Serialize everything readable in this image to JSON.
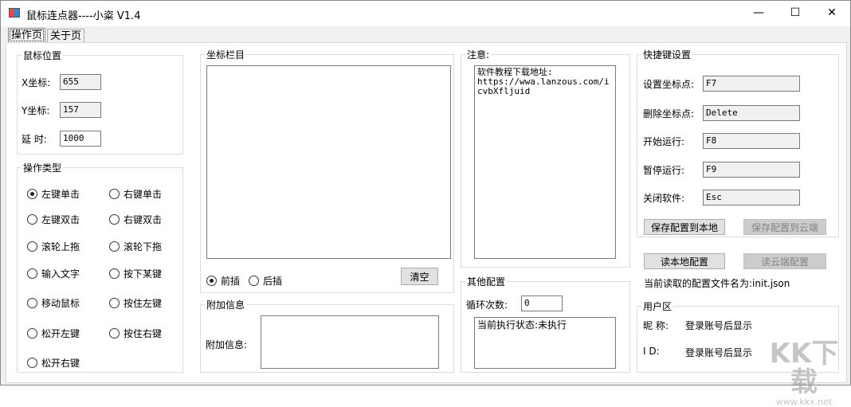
{
  "window": {
    "title": "鼠标连点器----小粢 V1.4",
    "minimize": "—",
    "maximize": "☐",
    "close": "✕"
  },
  "tabs": [
    "操作页",
    "关于页"
  ],
  "mouse_pos": {
    "title": "鼠标位置",
    "x_label": "X坐标:",
    "x_value": "655",
    "y_label": "Y坐标:",
    "y_value": "157",
    "delay_label": "延 时:",
    "delay_value": "1000"
  },
  "op_type": {
    "title": "操作类型",
    "options": [
      "左键单击",
      "右键单击",
      "左键双击",
      "右键双击",
      "滚轮上拖",
      "滚轮下拖",
      "输入文字",
      "按下某键",
      "移动鼠标",
      "按住左键",
      "松开左键",
      "按住右键",
      "松开右键"
    ],
    "selected": "左键单击"
  },
  "coords": {
    "title": "坐标栏目",
    "insert_before": "前插",
    "insert_after": "后插",
    "clear": "清空"
  },
  "extra": {
    "title": "附加信息",
    "label": "附加信息:"
  },
  "notice": {
    "title": "注意:",
    "text": "软件教程下载地址:\nhttps://wwa.lanzous.com/icvbXfljuid"
  },
  "other": {
    "title": "其他配置",
    "loop_label": "循环次数:",
    "loop_value": "0",
    "status": "当前执行状态:未执行"
  },
  "hotkeys": {
    "title": "快捷键设置",
    "items": [
      {
        "label": "设置坐标点:",
        "value": "F7"
      },
      {
        "label": "删除坐标点:",
        "value": "Delete"
      },
      {
        "label": "开始运行:",
        "value": "F8"
      },
      {
        "label": "暂停运行:",
        "value": "F9"
      },
      {
        "label": "关闭软件:",
        "value": "Esc"
      }
    ],
    "save_local": "保存配置到本地",
    "save_cloud": "保存配置到云端",
    "read_local": "读本地配置",
    "read_cloud": "读云端配置",
    "config_file": "当前读取的配置文件名为:init.json"
  },
  "user": {
    "title": "用户区",
    "nick_label": "昵 称:",
    "nick_value": "登录账号后显示",
    "id_label": "I D:",
    "id_value": "登录账号后显示"
  },
  "watermark": {
    "text": "KK下载",
    "url": "www.kkx.net"
  }
}
